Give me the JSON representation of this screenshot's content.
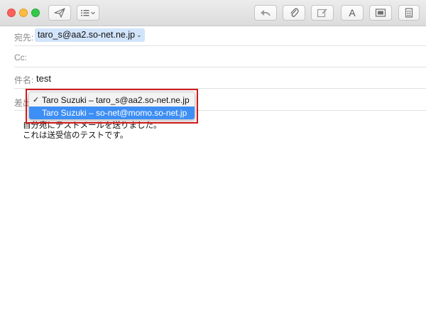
{
  "window": {
    "controls": [
      "close",
      "minimize",
      "zoom"
    ]
  },
  "toolbar": {
    "buttons": [
      {
        "name": "send",
        "icon": "paper-plane-icon"
      },
      {
        "name": "header-fields",
        "icon": "list-icon"
      },
      {
        "name": "reply",
        "icon": "reply-arrow-icon"
      },
      {
        "name": "attach",
        "icon": "paperclip-icon"
      },
      {
        "name": "markup",
        "icon": "markup-icon"
      },
      {
        "name": "format",
        "label": "A"
      },
      {
        "name": "photo-browser",
        "icon": "photo-icon"
      },
      {
        "name": "stationery",
        "icon": "stationery-icon"
      }
    ]
  },
  "header": {
    "to_label": "宛先:",
    "to_value": "taro_s@aa2.so-net.ne.jp",
    "cc_label": "Cc:",
    "subject_label": "件名:",
    "subject_value": "test",
    "from_label": "差出"
  },
  "from_menu": {
    "items": [
      {
        "label": "Taro Suzuki – taro_s@aa2.so-net.ne.jp",
        "checked": "✓"
      },
      {
        "label": "Taro Suzuki – so-net@momo.so-net.jp",
        "selected": true
      }
    ]
  },
  "body": {
    "line1": "自分宛にテストメールを送りました。",
    "line2": "これは送受信のテストです。"
  },
  "colors": {
    "highlight_border": "#d21a1a",
    "menu_selected": "#3d8ef5",
    "token_bg": "#d2e4fb"
  }
}
